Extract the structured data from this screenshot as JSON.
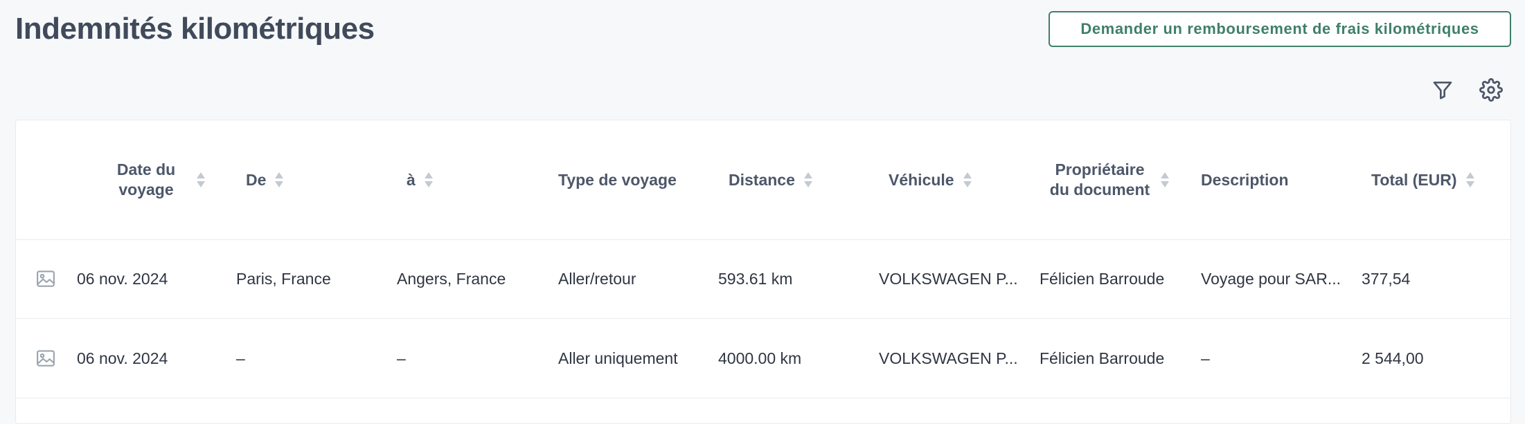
{
  "page": {
    "title": "Indemnités kilométriques",
    "action_button_label": "Demander un remboursement de frais kilométriques"
  },
  "toolbar": {
    "icons": [
      "filter-icon",
      "gear-icon"
    ]
  },
  "colors": {
    "accent": "#3f7f6a",
    "background": "#f6f8fa",
    "title": "#404a5a",
    "header_text": "#4d5769",
    "sort_icon": "#c4c9d1"
  },
  "table": {
    "columns": [
      {
        "label": "Date du voyage",
        "sortable": true
      },
      {
        "label": "De",
        "sortable": true
      },
      {
        "label": "à",
        "sortable": true
      },
      {
        "label": "Type de voyage",
        "sortable": false
      },
      {
        "label": "Distance",
        "sortable": true
      },
      {
        "label": "Véhicule",
        "sortable": true
      },
      {
        "label": "Propriétaire du document",
        "sortable": true
      },
      {
        "label": "Description",
        "sortable": false
      },
      {
        "label": "Total (EUR)",
        "sortable": true
      }
    ],
    "rows": [
      {
        "icon": "image-icon",
        "date": "06 nov. 2024",
        "from": "Paris, France",
        "to": "Angers, France",
        "trip_type": "Aller/retour",
        "distance": "593.61 km",
        "vehicle": "VOLKSWAGEN P...",
        "owner": "Félicien Barroude",
        "description": "Voyage pour SAR...",
        "total": "377,54"
      },
      {
        "icon": "image-icon",
        "date": "06 nov. 2024",
        "from": "–",
        "to": "–",
        "trip_type": "Aller uniquement",
        "distance": "4000.00 km",
        "vehicle": "VOLKSWAGEN P...",
        "owner": "Félicien Barroude",
        "description": "–",
        "total": "2 544,00"
      }
    ]
  }
}
